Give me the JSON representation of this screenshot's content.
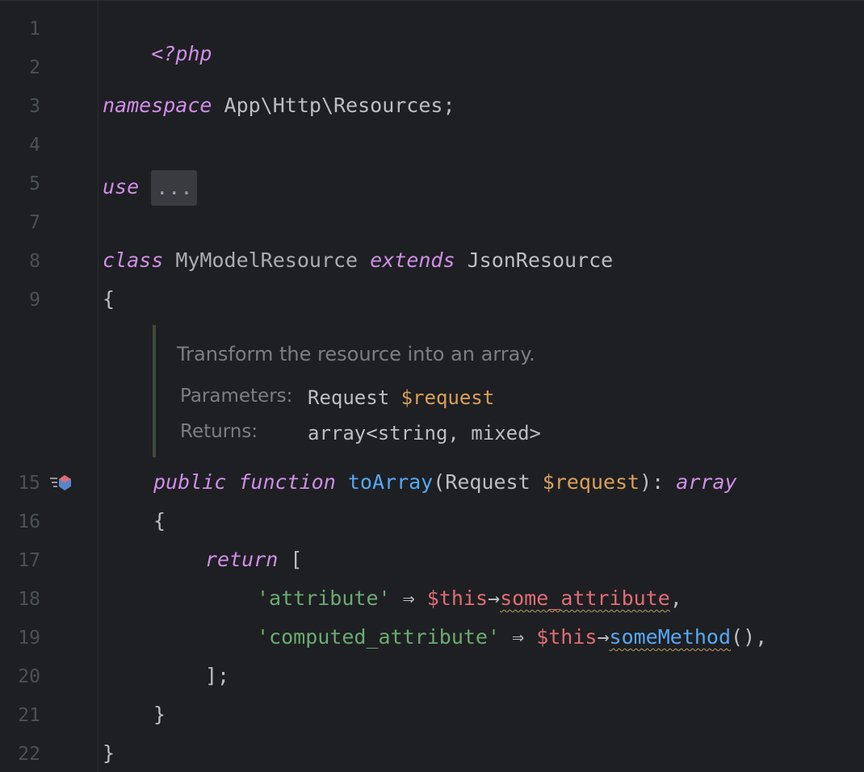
{
  "editor": {
    "line_numbers": [
      "1",
      "2",
      "3",
      "4",
      "5",
      "7",
      "8",
      "9",
      "15",
      "16",
      "17",
      "18",
      "19",
      "20",
      "21",
      "22"
    ],
    "line1": {
      "open_tag": "<?php"
    },
    "line3": {
      "keyword": "namespace",
      "name": "App\\Http\\Resources;"
    },
    "line5": {
      "keyword": "use",
      "folded": "..."
    },
    "line8": {
      "keyword_class": "class",
      "class_name": "MyModelResource",
      "keyword_extends": "extends",
      "parent": "JsonResource"
    },
    "line9": {
      "brace": "{"
    },
    "docblock": {
      "description": "Transform the resource into an array.",
      "params_label": "Parameters:",
      "params_type": "Request",
      "params_var": "$request",
      "returns_label": "Returns:",
      "returns_value": "array<string, mixed>"
    },
    "line15": {
      "kw_public": "public",
      "kw_function": "function",
      "fn_name": "toArray",
      "open_paren": "(",
      "param_type": "Request ",
      "param_var": "$request",
      "close": "): ",
      "return_type": "array",
      "gutter_icon": "implements-method-icon"
    },
    "line16": {
      "brace": "{"
    },
    "line17": {
      "kw_return": "return",
      "bracket": " ["
    },
    "line18": {
      "key": "'attribute'",
      "arrow": " ⇒ ",
      "this": "$this",
      "access": "→",
      "prop": "some_attribute",
      "tail": ","
    },
    "line19": {
      "key": "'computed_attribute'",
      "arrow": " ⇒ ",
      "this": "$this",
      "access": "→",
      "method": "someMethod",
      "tail": "(),"
    },
    "line20": {
      "text": "];"
    },
    "line21": {
      "text": "}"
    },
    "line22": {
      "text": "}"
    }
  },
  "colors": {
    "background": "#1e1f22",
    "keyword": "#cf8ee8",
    "function": "#56a8f5",
    "string": "#6aab73",
    "variable": "#d9a05b",
    "this": "#e06c75"
  }
}
